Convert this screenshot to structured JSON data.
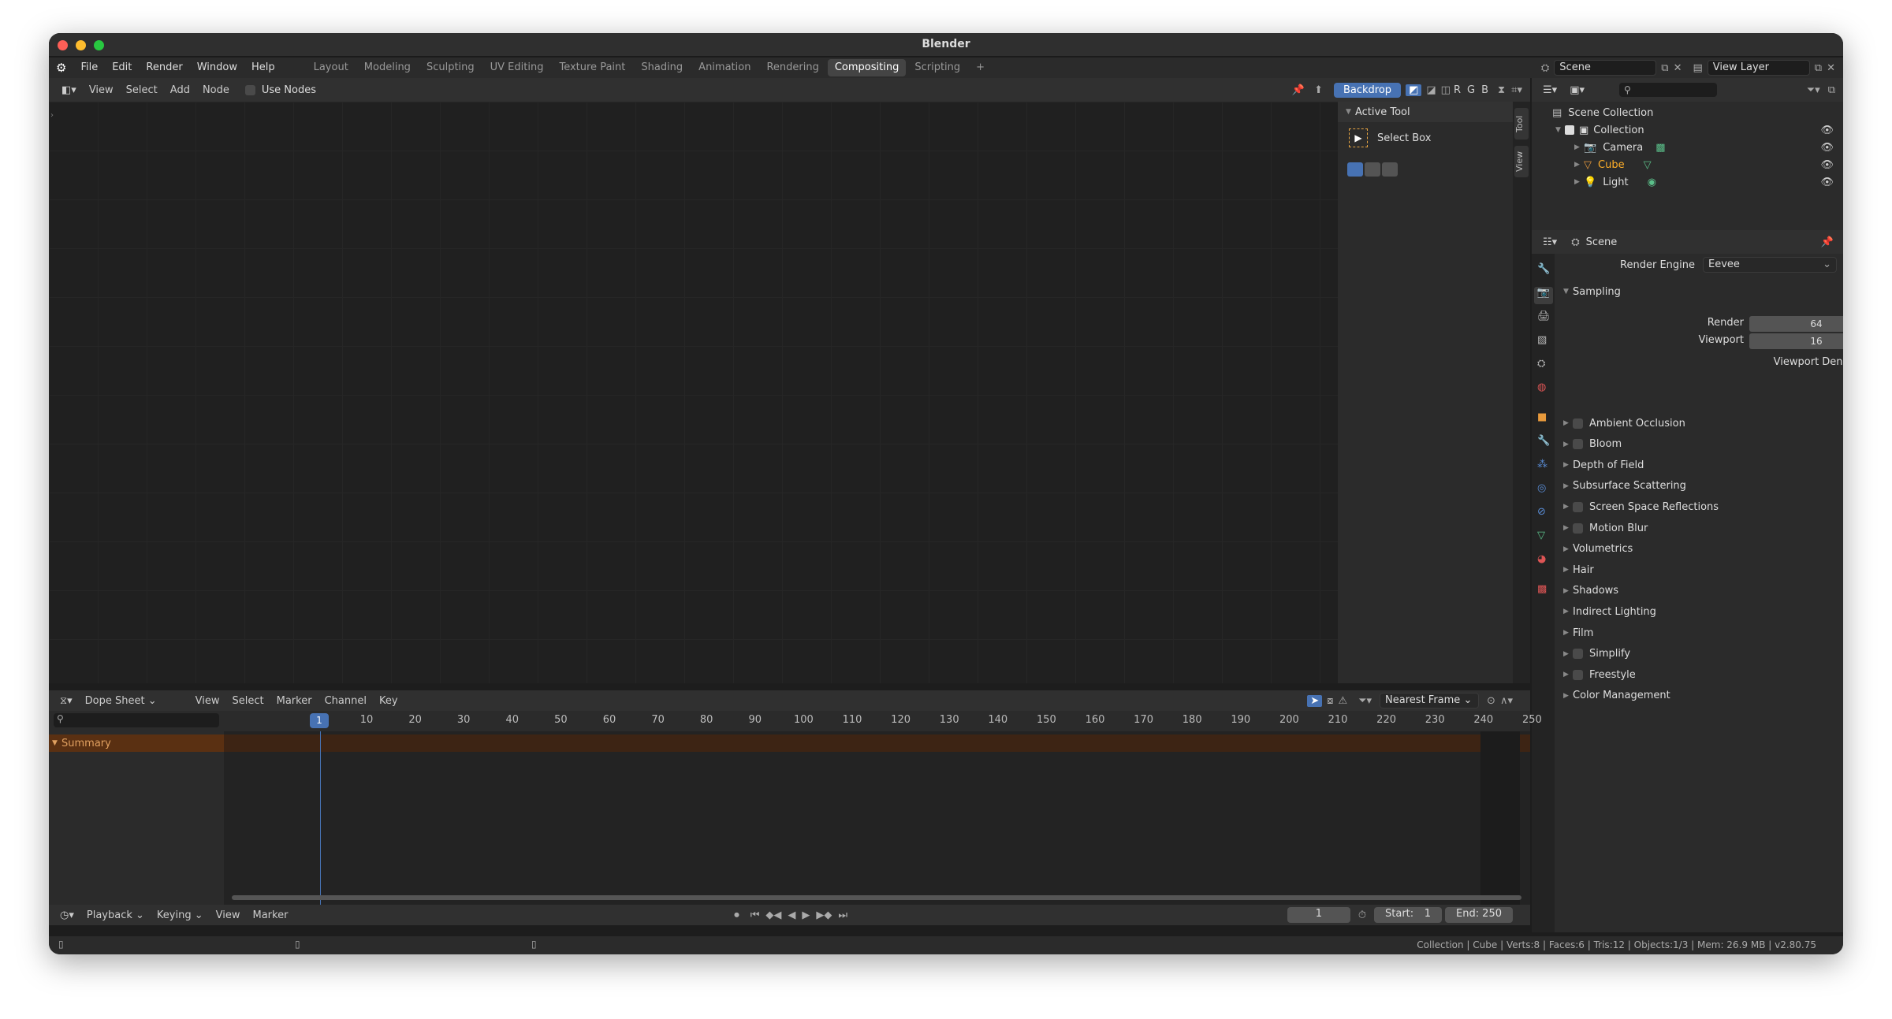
{
  "window": {
    "title": "Blender"
  },
  "menu": [
    "File",
    "Edit",
    "Render",
    "Window",
    "Help"
  ],
  "workspaces": [
    "Layout",
    "Modeling",
    "Sculpting",
    "UV Editing",
    "Texture Paint",
    "Shading",
    "Animation",
    "Rendering",
    "Compositing",
    "Scripting",
    "+"
  ],
  "active_workspace": "Compositing",
  "scene_field": "Scene",
  "viewlayer_field": "View Layer",
  "node_header": {
    "view": "View",
    "select": "Select",
    "add": "Add",
    "node": "Node",
    "use_nodes": "Use Nodes",
    "backdrop": "Backdrop",
    "channels": [
      "R",
      "G",
      "B"
    ]
  },
  "npanel": {
    "section": "Active Tool",
    "tool": "Select Box",
    "tabs": [
      "Tool",
      "View"
    ]
  },
  "outliner": {
    "root": "Scene Collection",
    "collection": "Collection",
    "items": [
      "Camera",
      "Cube",
      "Light"
    ]
  },
  "properties": {
    "context": "Scene",
    "render_engine_label": "Render Engine",
    "render_engine": "Eevee",
    "sampling": "Sampling",
    "render_label": "Render",
    "render_value": "64",
    "viewport_label": "Viewport",
    "viewport_value": "16",
    "denoising_label": "Viewport Denoising",
    "panels": [
      {
        "label": "Ambient Occlusion",
        "check": true
      },
      {
        "label": "Bloom",
        "check": true
      },
      {
        "label": "Depth of Field",
        "check": false
      },
      {
        "label": "Subsurface Scattering",
        "check": false
      },
      {
        "label": "Screen Space Reflections",
        "check": true
      },
      {
        "label": "Motion Blur",
        "check": true
      },
      {
        "label": "Volumetrics",
        "check": false
      },
      {
        "label": "Hair",
        "check": false
      },
      {
        "label": "Shadows",
        "check": false
      },
      {
        "label": "Indirect Lighting",
        "check": false
      },
      {
        "label": "Film",
        "check": false
      },
      {
        "label": "Simplify",
        "check": true
      },
      {
        "label": "Freestyle",
        "check": true
      },
      {
        "label": "Color Management",
        "check": false
      }
    ]
  },
  "dopesheet": {
    "mode": "Dope Sheet",
    "view": "View",
    "select": "Select",
    "marker": "Marker",
    "channel": "Channel",
    "key": "Key",
    "snap": "Nearest Frame",
    "summary": "Summary",
    "current_frame": "1",
    "ticks": [
      "10",
      "20",
      "30",
      "40",
      "50",
      "60",
      "70",
      "80",
      "90",
      "100",
      "110",
      "120",
      "130",
      "140",
      "150",
      "160",
      "170",
      "180",
      "190",
      "200",
      "210",
      "220",
      "230",
      "240",
      "250"
    ]
  },
  "timeline": {
    "playback": "Playback",
    "keying": "Keying",
    "view": "View",
    "marker": "Marker",
    "frame": "1",
    "start_label": "Start:",
    "start": "1",
    "end_label": "End:",
    "end": "250"
  },
  "status": "Collection | Cube | Verts:8 | Faces:6 | Tris:12 | Objects:1/3 | Mem: 26.9 MB | v2.80.75",
  "colors": {
    "accent": "#4772b3",
    "active_orange": "#ffaf29",
    "summary_bg": "#5a3012"
  }
}
